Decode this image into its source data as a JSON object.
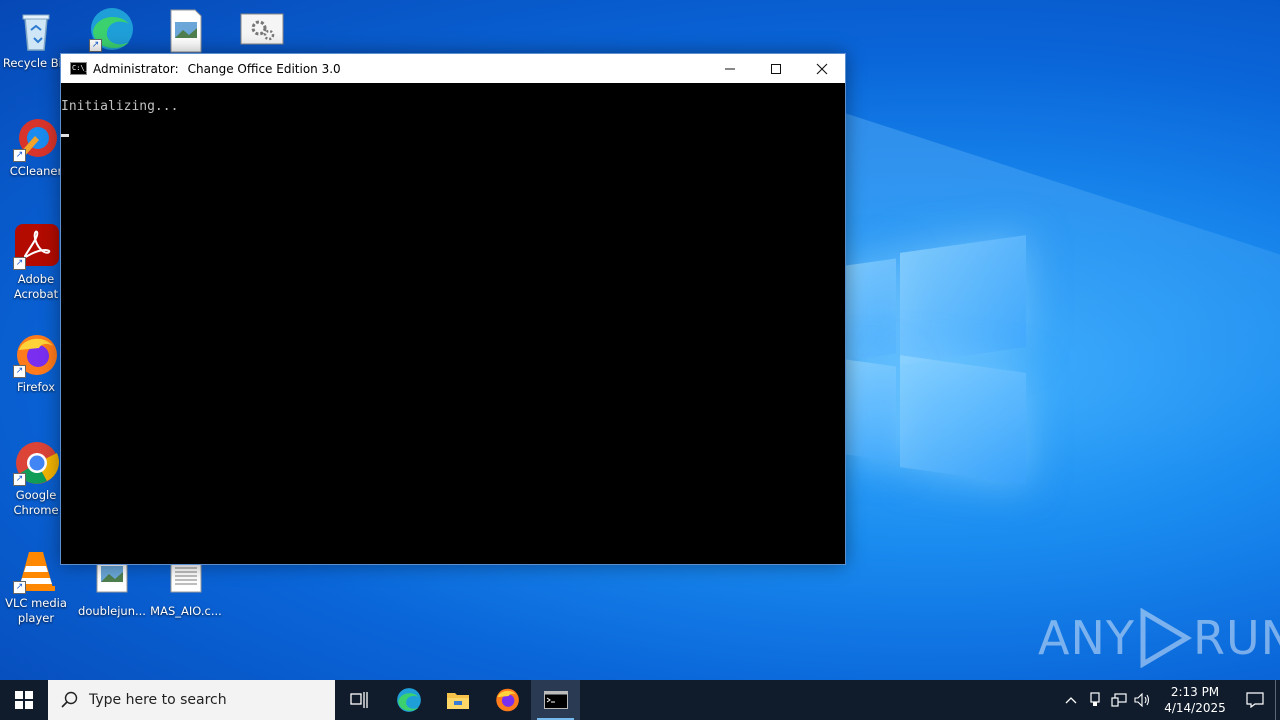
{
  "desktop": {
    "icons": [
      {
        "label": "Recycle Bin",
        "icon": "recycle-bin-icon"
      },
      {
        "label": "CCleaner",
        "icon": "ccleaner-icon"
      },
      {
        "label": "Adobe Acrobat",
        "icon": "adobe-acrobat-icon"
      },
      {
        "label": "Firefox",
        "icon": "firefox-icon"
      },
      {
        "label": "Google Chrome",
        "icon": "chrome-icon"
      },
      {
        "label": "VLC media player",
        "icon": "vlc-icon"
      },
      {
        "label": "doublejun...",
        "icon": "image-file-icon"
      },
      {
        "label": "MAS_AIO.c...",
        "icon": "text-file-icon"
      }
    ]
  },
  "window": {
    "title_prefix": "Administrator:",
    "title": "Change Office Edition 3.0",
    "console_line": "Initializing..."
  },
  "taskbar": {
    "search_placeholder": "Type here to search",
    "apps": [
      "task-view-icon",
      "edge-icon",
      "file-explorer-icon",
      "firefox-icon",
      "command-prompt-icon"
    ],
    "active_app": "command-prompt-icon"
  },
  "tray": {
    "time": "2:13 PM",
    "date": "4/14/2025"
  },
  "watermark": {
    "left": "ANY",
    "right": "RUN"
  },
  "colors": {
    "desktop_blue": "#0a66d9",
    "taskbar": "#101c2c",
    "console_bg": "#000000",
    "console_text": "#c0c0c0"
  }
}
